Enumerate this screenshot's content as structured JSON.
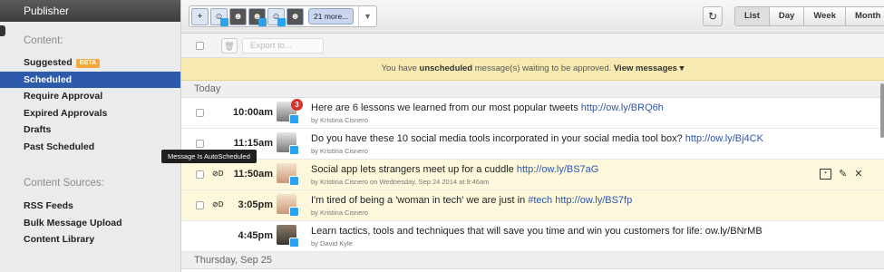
{
  "sidebar": {
    "title": "Publisher",
    "content_heading": "Content:",
    "items": [
      {
        "label": "Suggested",
        "badge": "BETA"
      },
      {
        "label": "Scheduled",
        "active": true
      },
      {
        "label": "Require Approval"
      },
      {
        "label": "Expired Approvals"
      },
      {
        "label": "Drafts"
      },
      {
        "label": "Past Scheduled"
      }
    ],
    "sources_heading": "Content Sources:",
    "sources": [
      {
        "label": "RSS Feeds"
      },
      {
        "label": "Bulk Message Upload"
      },
      {
        "label": "Content Library"
      }
    ]
  },
  "toolbar": {
    "more_profiles": "21 more...",
    "views": [
      "List",
      "Day",
      "Week",
      "Month"
    ],
    "active_view": "List",
    "export_placeholder": "Export to..."
  },
  "banner": {
    "prefix": "You have",
    "emphasis": "unscheduled",
    "suffix": "message(s) waiting to be approved.",
    "link": "View messages"
  },
  "sections": [
    {
      "label": "Today"
    },
    {
      "label": "Thursday, Sep 25"
    }
  ],
  "messages": [
    {
      "time": "10:00am",
      "text": "Here are 6 lessons we learned from our most popular tweets ",
      "link": "http://ow.ly/BRQ6h",
      "by": "by Kristina Cisnero",
      "badge": "3"
    },
    {
      "time": "11:15am",
      "text": "Do you have these 10 social media tools incorporated in your social media tool box? ",
      "link": "http://ow.ly/Bj4CK",
      "by": "by Kristina Cisnero"
    },
    {
      "time": "11:50am",
      "text": "Social app lets strangers meet up for a cuddle ",
      "link": "http://ow.ly/BS7aG",
      "by": "by Kristina Cisnero on Wednesday, Sep 24 2014 at 9:46am",
      "tooltip": "Message Is AutoScheduled"
    },
    {
      "time": "3:05pm",
      "text": "I'm tired of being a 'woman in tech' we are just in ",
      "hashtag": "#tech",
      "link": "http://ow.ly/BS7fp",
      "by": "by Kristina Cisnero"
    },
    {
      "time": "4:45pm",
      "text": "Learn tactics, tools and techniques that will save you time and win you customers for life: ow.ly/BNrMB",
      "by": "by David Kyle"
    }
  ],
  "colors": {
    "accent": "#2e5aac",
    "banner": "#f6eab2",
    "highlight_row": "#fdf8dc",
    "link": "#2f56a6"
  }
}
